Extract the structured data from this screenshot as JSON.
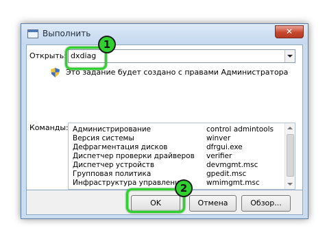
{
  "window": {
    "title": "Выполнить",
    "close_glyph": "✕"
  },
  "open": {
    "label": "Открыть:",
    "value": "dxdiag"
  },
  "admin_note": "Это задание будет создано с правами Администратора",
  "commands": {
    "label": "Команды:",
    "rows": [
      {
        "name": "Администрирование",
        "value": "control admintools"
      },
      {
        "name": "Версия системы",
        "value": "winver"
      },
      {
        "name": "Дефрагментация дисков",
        "value": "dfrgui.exe"
      },
      {
        "name": "Диспетчер проверки драйверов",
        "value": "verifier"
      },
      {
        "name": "Диспетчер устройств",
        "value": "devmgmt.msc"
      },
      {
        "name": "Групповая политика",
        "value": "gpedit.msc"
      },
      {
        "name": "Инфраструктура управления",
        "value": "wmimgmt.msc"
      }
    ]
  },
  "buttons": {
    "ok": "OK",
    "cancel": "Отмена",
    "browse": "Обзор..."
  },
  "annotations": {
    "badge_1": "1",
    "badge_2": "2"
  },
  "colors": {
    "highlight": "#2fd02f",
    "window_frame": "#c9dcf0",
    "close_button": "#c7472f"
  },
  "icons": {
    "title": "run-app-icon",
    "shield": "uac-shield-icon"
  }
}
